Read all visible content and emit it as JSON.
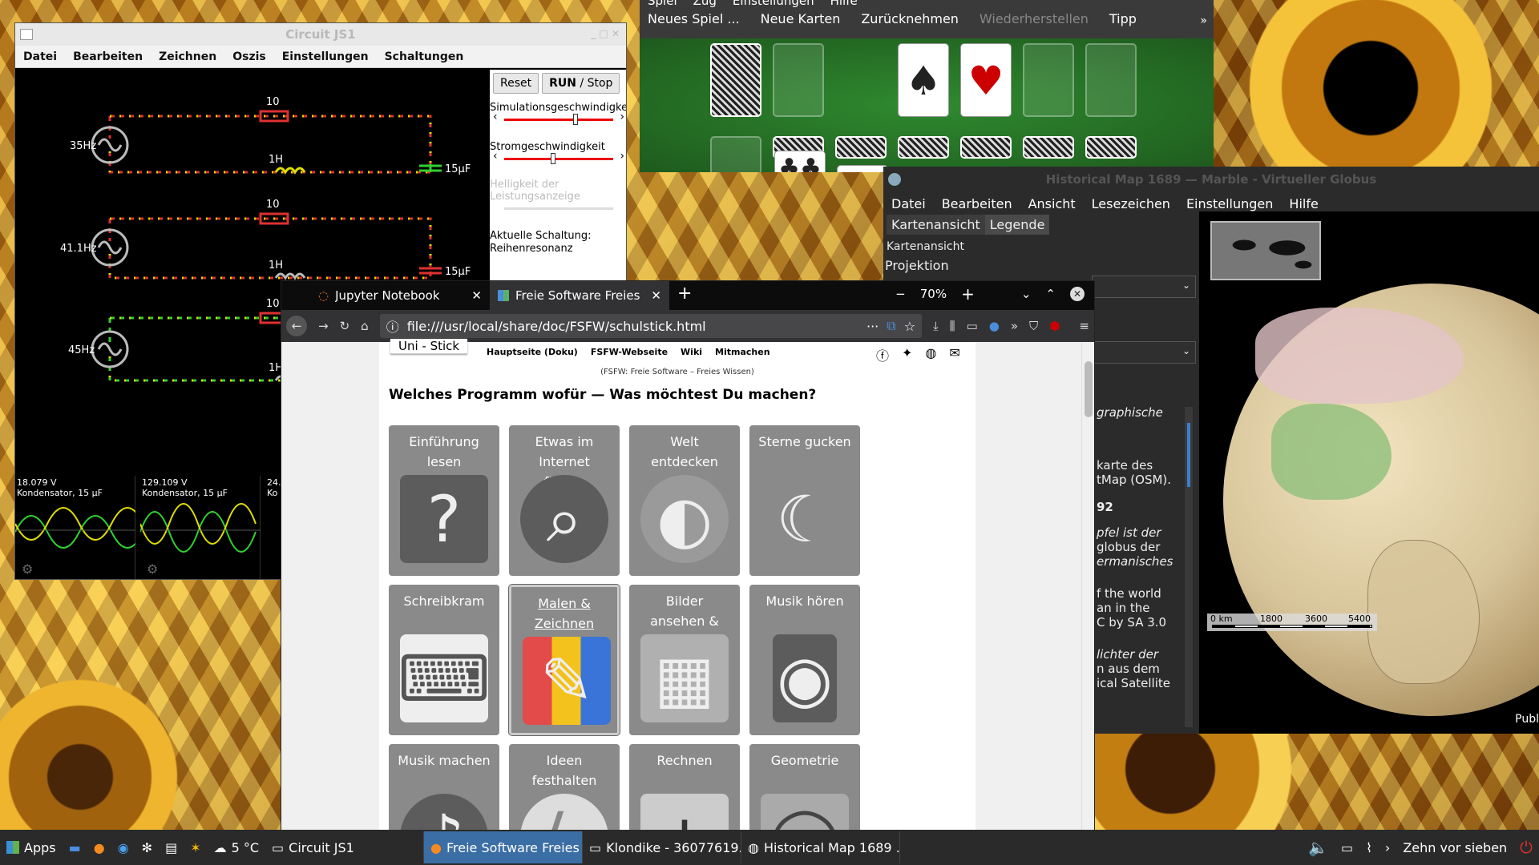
{
  "circuit": {
    "title": "Circuit JS1",
    "menu": [
      "Datei",
      "Bearbeiten",
      "Zeichnen",
      "Oszis",
      "Einstellungen",
      "Schaltungen"
    ],
    "reset_label": "Reset",
    "run_label": "RUN",
    "stop_label": "/ Stop",
    "sim_speed_label": "Simulationsgeschwindigkeit",
    "current_speed_label": "Stromgeschwindigkeit",
    "brightness_label": "Helligkeit der Leistungsanzeige",
    "current_circuit_label": "Aktuelle Schaltung:",
    "current_circuit_value": "Reihenresonanz",
    "sources": [
      "35Hz",
      "41.1Hz",
      "45Hz"
    ],
    "resistors": [
      "10",
      "10",
      "10"
    ],
    "inductors": [
      "1H",
      "1H",
      "1H"
    ],
    "capacitors": [
      "15µF",
      "15µF"
    ],
    "scopes": [
      {
        "voltage": "18.079 V",
        "label": "Kondensator, 15 µF"
      },
      {
        "voltage": "129.109 V",
        "label": "Kondensator, 15 µF"
      },
      {
        "voltage": "24.",
        "label": "Ko"
      }
    ]
  },
  "klondike": {
    "menu_top": [
      "Spiel",
      "Zug",
      "Einstellungen",
      "Hilfe"
    ],
    "toolbar": [
      "Neues Spiel ...",
      "Neue Karten",
      "Zurücknehmen",
      "Wiederherstellen",
      "Tipp"
    ],
    "more": "»"
  },
  "marble": {
    "title": "Historical Map 1689 — Marble - Virtueller Globus",
    "menu": [
      "Datei",
      "Bearbeiten",
      "Ansicht",
      "Lesezeichen",
      "Einstellungen",
      "Hilfe"
    ],
    "tabs": [
      "Kartenansicht",
      "Legende"
    ],
    "section_label": "Kartenansicht",
    "projection_label": "Projektion",
    "legend_text": [
      "graphische",
      "karte des",
      "tMap (OSM).",
      "92",
      "pfel ist der",
      "globus der",
      "ermanisches",
      "f the world",
      "an in the",
      "C by SA 3.0",
      "lichter der",
      "n aus dem",
      "ical Satellite"
    ],
    "scale": [
      "0 km",
      "1800",
      "3600",
      "5400"
    ],
    "publ": "Publ"
  },
  "firefox": {
    "tabs": [
      {
        "label": "Jupyter Notebook"
      },
      {
        "label": "Freie Software Freies W"
      }
    ],
    "zoom": "70%",
    "url": "file:///usr/local/share/doc/FSFW/schulstick.html",
    "site_logo": "Uni - Stick",
    "site_nav": [
      "Hauptseite (Doku)",
      "FSFW-Webseite",
      "Wiki",
      "Mitmachen"
    ],
    "subtitle": "(FSFW: Freie Software – Freies Wissen)",
    "heading": "Welches Programm wofür — Was möchtest Du machen?",
    "tiles": [
      {
        "label": "Einführung lesen",
        "icon": "?"
      },
      {
        "label": "Etwas im Internet finden",
        "icon": "⌕"
      },
      {
        "label": "Welt entdecken",
        "icon": "◐"
      },
      {
        "label": "Sterne gucken",
        "icon": "☾"
      },
      {
        "label": "Schreibkram",
        "icon": "⌨"
      },
      {
        "label": "Malen & Zeichnen",
        "icon": "✎"
      },
      {
        "label": "Bilder ansehen & bearbeiten",
        "icon": "▦"
      },
      {
        "label": "Musik hören",
        "icon": "◉"
      },
      {
        "label": "Musik machen",
        "icon": "♪"
      },
      {
        "label": "Ideen festhalten",
        "icon": "ϟ"
      },
      {
        "label": "Rechnen",
        "icon": "±"
      },
      {
        "label": "Geometrie",
        "icon": "◯"
      }
    ]
  },
  "taskbar": {
    "apps_label": "Apps",
    "weather": "5 °C",
    "tasks": [
      "Circuit JS1",
      "Freie Software Freies ...",
      "Klondike - 36077619...",
      "Historical Map 1689 ..."
    ],
    "clock": "Zehn vor sieben"
  }
}
